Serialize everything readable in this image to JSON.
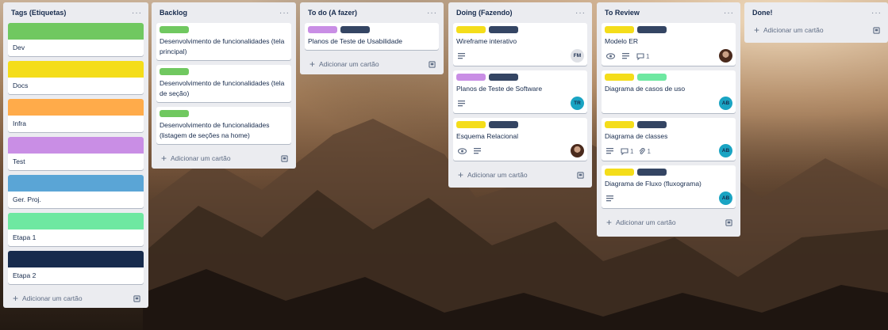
{
  "colors": {
    "dev": "#70c860",
    "docs": "#f4dd1a",
    "infra": "#ffab4a",
    "test": "#c98ee5",
    "ger_proj": "#5aa5d6",
    "etapa1": "#6ee8a1",
    "etapa2": "#172b4d",
    "dark_label": "#344563"
  },
  "add_card_label": "Adicionar um cartão",
  "lists": [
    {
      "title": "Tags (Etiquetas)",
      "tags": [
        {
          "name": "Dev",
          "color": "#70c860"
        },
        {
          "name": "Docs",
          "color": "#f4dd1a"
        },
        {
          "name": "Infra",
          "color": "#ffab4a"
        },
        {
          "name": "Test",
          "color": "#c98ee5"
        },
        {
          "name": "Ger. Proj.",
          "color": "#5aa5d6"
        },
        {
          "name": "Etapa 1",
          "color": "#6ee8a1"
        },
        {
          "name": "Etapa 2",
          "color": "#172b4d"
        }
      ]
    },
    {
      "title": "Backlog",
      "cards": [
        {
          "title": "Desenvolvimento de funcionalidades (tela principal)"
        },
        {
          "title": "Desenvolvimento de funcionalidades (tela de seção)"
        },
        {
          "title": "Desenvolvimento de funcionalidades (listagem de seções na home)"
        }
      ]
    },
    {
      "title": "To do (A fazer)",
      "cards": [
        {
          "title": "Planos de Teste de Usabilidade"
        }
      ]
    },
    {
      "title": "Doing (Fazendo)",
      "cards": [
        {
          "title": "Wireframe interativo",
          "avatar": "FM"
        },
        {
          "title": "Planos de Teste de Software",
          "avatar": "TR"
        },
        {
          "title": "Esquema Relacional"
        }
      ]
    },
    {
      "title": "To Review",
      "cards": [
        {
          "title": "Modelo ER",
          "comments": "1"
        },
        {
          "title": "Diagrama de casos de uso",
          "avatar": "AB"
        },
        {
          "title": "Diagrama de classes",
          "comments": "1",
          "attachments": "1",
          "avatar": "AB"
        },
        {
          "title": "Diagrama de Fluxo (fluxograma)",
          "avatar": "AB"
        }
      ]
    },
    {
      "title": "Done!"
    }
  ]
}
